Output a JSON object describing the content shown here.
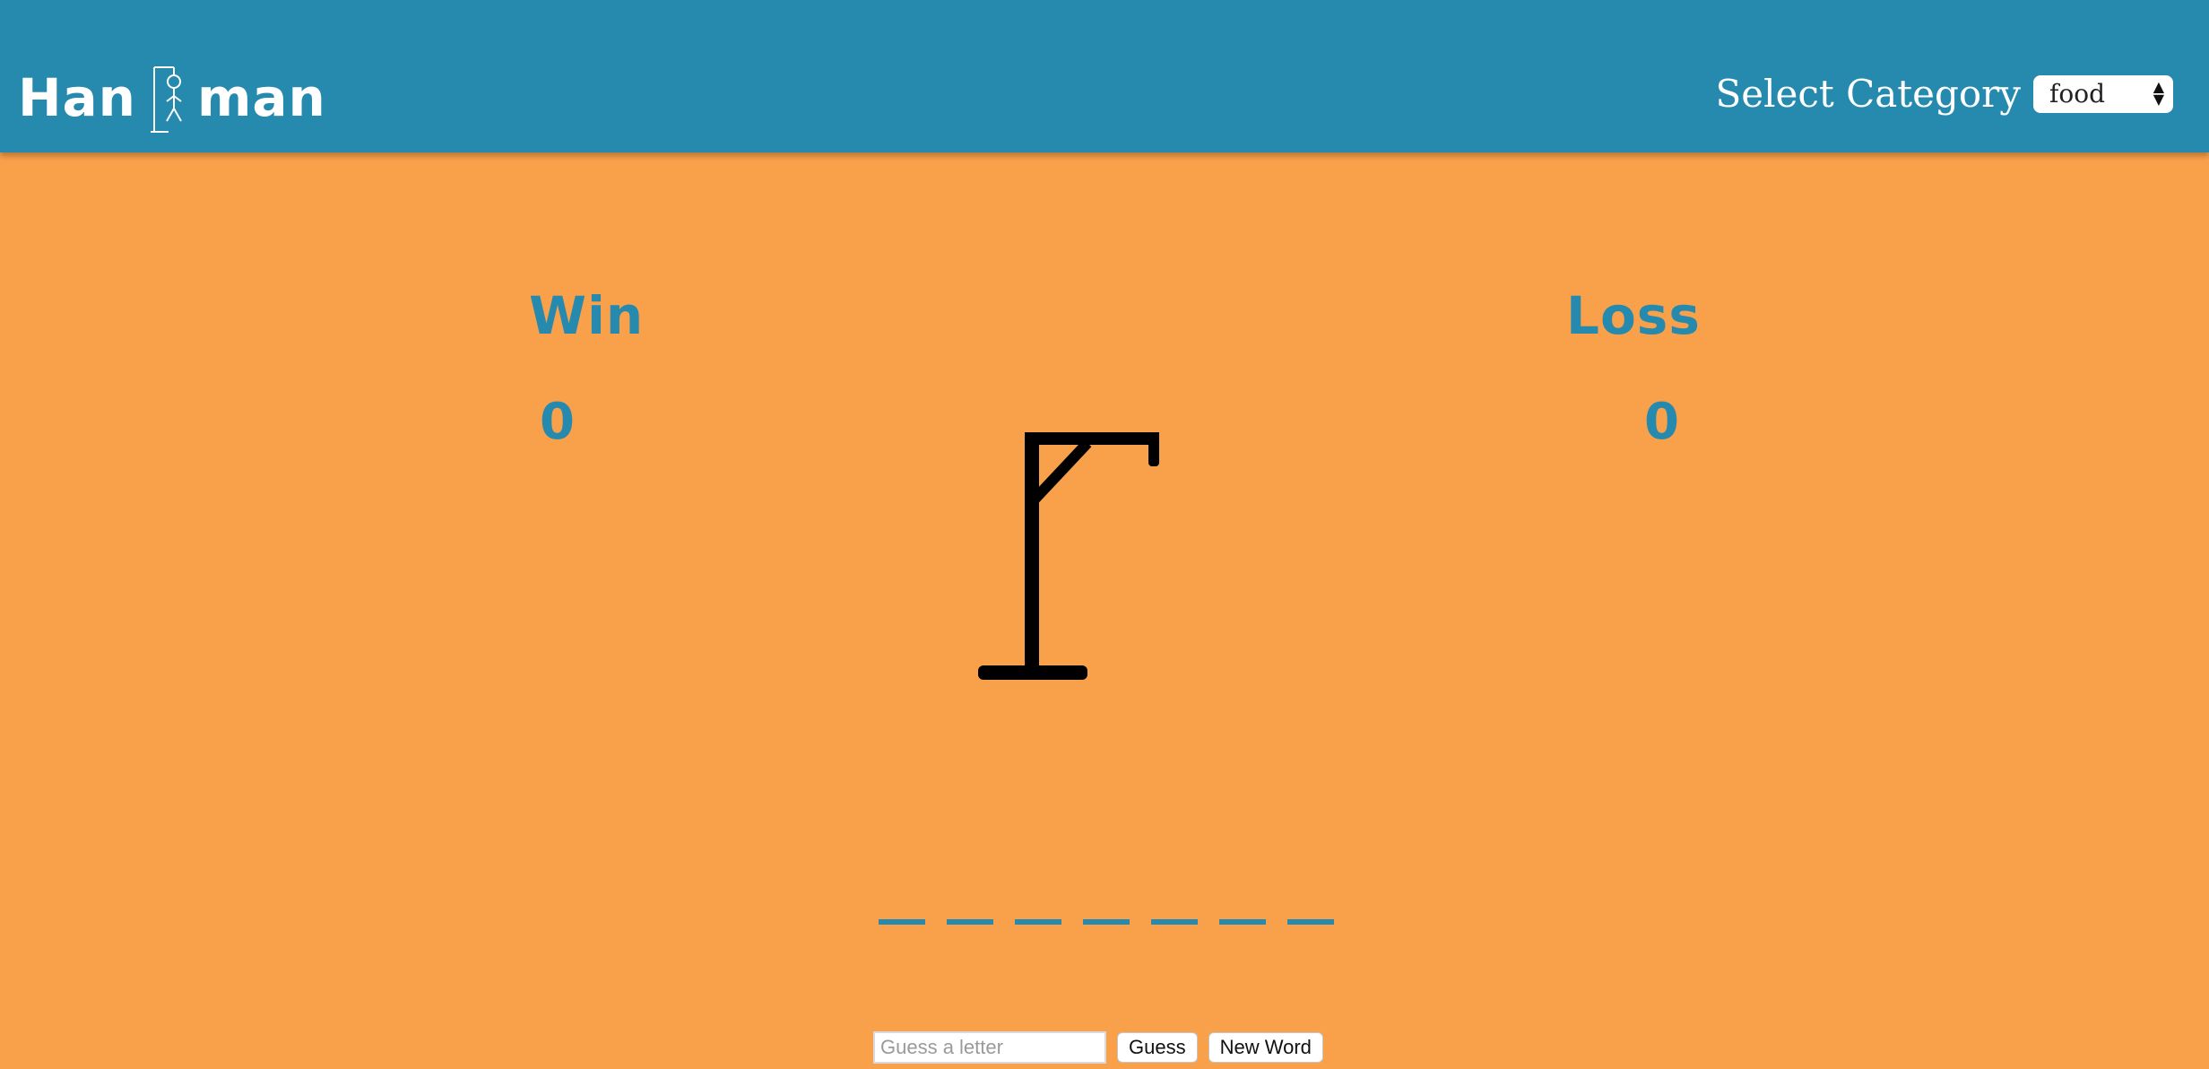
{
  "header": {
    "logo": {
      "left": "Han",
      "right": "man"
    },
    "category": {
      "label": "Select Category",
      "selected": "food"
    }
  },
  "scores": {
    "win": {
      "label": "Win",
      "value": "0"
    },
    "loss": {
      "label": "Loss",
      "value": "0"
    }
  },
  "game": {
    "blanks": 7,
    "colors": {
      "background": "#f9a04b",
      "header": "#268aaf",
      "accent": "#268aaf"
    }
  },
  "controls": {
    "input_placeholder": "Guess a letter",
    "guess_label": "Guess",
    "new_word_label": "New Word"
  }
}
